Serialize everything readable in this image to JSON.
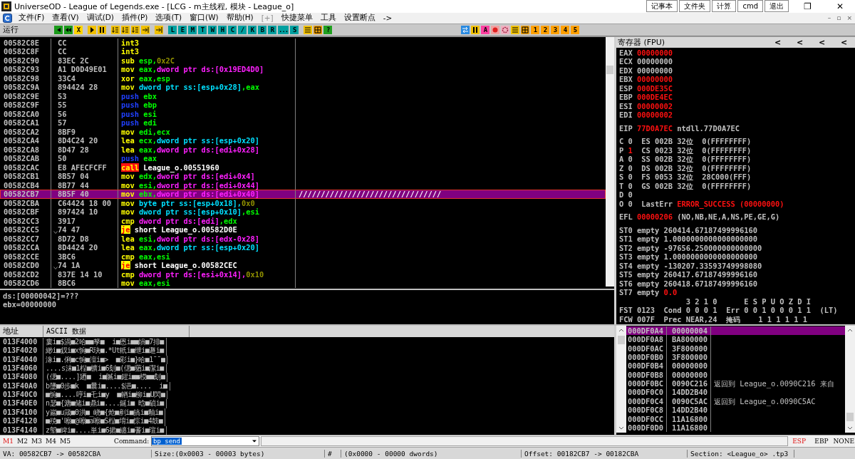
{
  "window": {
    "title": "UniverseOD - League of Legends.exe - [LCG - m主线程, 模块 - League_o]",
    "quick_buttons": [
      "记事本",
      "文件夹",
      "计算",
      "cmd",
      "退出"
    ],
    "controls": [
      "❐",
      "✕"
    ]
  },
  "menu": {
    "items": [
      {
        "label": "文件(F)",
        "dim": false
      },
      {
        "label": "查看(V)",
        "dim": false
      },
      {
        "label": "调试(D)",
        "dim": false
      },
      {
        "label": "插件(P)",
        "dim": false
      },
      {
        "label": "选项(T)",
        "dim": false
      },
      {
        "label": "窗口(W)",
        "dim": false
      },
      {
        "label": "帮助(H)",
        "dim": false
      },
      {
        "label": "[+]",
        "dim": true
      },
      {
        "label": "快捷菜单",
        "dim": false
      },
      {
        "label": "工具",
        "dim": false
      },
      {
        "label": "设置断点",
        "dim": false
      },
      {
        "label": "->",
        "dim": false
      }
    ],
    "mdi_controls": [
      "–",
      "▫",
      "×"
    ]
  },
  "toolbar": {
    "status": "运行",
    "groups": [
      [
        {
          "kind": "back"
        },
        {
          "kind": "fastback"
        },
        {
          "kind": "text",
          "label": "X",
          "color": "#ffd400"
        }
      ],
      [
        {
          "kind": "play"
        },
        {
          "kind": "pause"
        }
      ],
      [
        {
          "kind": "step"
        },
        {
          "kind": "step"
        },
        {
          "kind": "step"
        },
        {
          "kind": "stepout"
        }
      ],
      [
        {
          "kind": "stepout"
        }
      ],
      [
        {
          "kind": "text",
          "label": "L",
          "color": "#00a0a0"
        },
        {
          "kind": "text",
          "label": "E",
          "color": "#00a0a0"
        },
        {
          "kind": "text",
          "label": "M",
          "color": "#00a0a0"
        },
        {
          "kind": "text",
          "label": "T",
          "color": "#00a0a0"
        },
        {
          "kind": "text",
          "label": "W",
          "color": "#00a0a0"
        },
        {
          "kind": "text",
          "label": "H",
          "color": "#00a0a0"
        },
        {
          "kind": "text",
          "label": "C",
          "color": "#00a0a0"
        },
        {
          "kind": "text",
          "label": "/",
          "color": "#00a0a0"
        },
        {
          "kind": "text",
          "label": "K",
          "color": "#00a0a0"
        },
        {
          "kind": "text",
          "label": "B",
          "color": "#00a0a0"
        },
        {
          "kind": "text",
          "label": "R",
          "color": "#00a0a0"
        },
        {
          "kind": "text",
          "label": "...",
          "color": "#00a0a0"
        },
        {
          "kind": "text",
          "label": "S",
          "color": "#00a0a0"
        }
      ],
      [
        {
          "kind": "list"
        },
        {
          "kind": "grid"
        },
        {
          "kind": "text",
          "label": "?",
          "color": "#20a020"
        }
      ]
    ],
    "right_group": [
      {
        "kind": "swap"
      },
      {
        "kind": "pause"
      },
      {
        "kind": "text",
        "label": "A",
        "color": "#ff40a0"
      },
      {
        "kind": "circle"
      },
      {
        "kind": "gear"
      },
      {
        "kind": "list"
      },
      {
        "kind": "grid"
      },
      {
        "kind": "text",
        "label": "1",
        "color": "#ffa000"
      },
      {
        "kind": "text",
        "label": "2",
        "color": "#ffa000"
      },
      {
        "kind": "text",
        "label": "3",
        "color": "#ffa000"
      },
      {
        "kind": "text",
        "label": "4",
        "color": "#ffa000"
      },
      {
        "kind": "text",
        "label": "5",
        "color": "#ffa000"
      }
    ]
  },
  "disassembly": {
    "rows": [
      {
        "address": "00582C8E",
        "hex": "CC",
        "jump": false,
        "selected": false,
        "parts": [
          {
            "kind": "m",
            "text": "int3"
          }
        ]
      },
      {
        "address": "00582C8F",
        "hex": "CC",
        "jump": false,
        "selected": false,
        "parts": [
          {
            "kind": "m",
            "text": "int3"
          }
        ]
      },
      {
        "address": "00582C90",
        "hex": "83EC 2C",
        "jump": false,
        "selected": false,
        "parts": [
          {
            "kind": "m",
            "text": "sub"
          },
          {
            "kind": "r",
            "text": " esp,"
          },
          {
            "kind": "i",
            "text": "0x2C"
          }
        ]
      },
      {
        "address": "00582C93",
        "hex": "A1 D0D49E01",
        "jump": false,
        "selected": false,
        "parts": [
          {
            "kind": "m",
            "text": "mov"
          },
          {
            "kind": "r",
            "text": " eax,"
          },
          {
            "kind": "d",
            "text": "dword ptr ds:[0x19ED4D0]"
          }
        ]
      },
      {
        "address": "00582C98",
        "hex": "33C4",
        "jump": false,
        "selected": false,
        "parts": [
          {
            "kind": "m",
            "text": "xor"
          },
          {
            "kind": "r",
            "text": " eax,esp"
          }
        ]
      },
      {
        "address": "00582C9A",
        "hex": "894424 28",
        "jump": false,
        "selected": false,
        "parts": [
          {
            "kind": "m",
            "text": "mov"
          },
          {
            "kind": "s",
            "text": " dword ptr ss:[esp+0x28]"
          },
          {
            "kind": "r",
            "text": ",eax"
          }
        ]
      },
      {
        "address": "00582C9E",
        "hex": "53",
        "jump": false,
        "selected": false,
        "parts": [
          {
            "kind": "p",
            "text": "push"
          },
          {
            "kind": "r",
            "text": " ebx"
          }
        ]
      },
      {
        "address": "00582C9F",
        "hex": "55",
        "jump": false,
        "selected": false,
        "parts": [
          {
            "kind": "p",
            "text": "push"
          },
          {
            "kind": "r",
            "text": " ebp"
          }
        ]
      },
      {
        "address": "00582CA0",
        "hex": "56",
        "jump": false,
        "selected": false,
        "parts": [
          {
            "kind": "p",
            "text": "push"
          },
          {
            "kind": "r",
            "text": " esi"
          }
        ]
      },
      {
        "address": "00582CA1",
        "hex": "57",
        "jump": false,
        "selected": false,
        "parts": [
          {
            "kind": "p",
            "text": "push"
          },
          {
            "kind": "r",
            "text": " edi"
          }
        ]
      },
      {
        "address": "00582CA2",
        "hex": "8BF9",
        "jump": false,
        "selected": false,
        "parts": [
          {
            "kind": "m",
            "text": "mov"
          },
          {
            "kind": "r",
            "text": " edi,ecx"
          }
        ]
      },
      {
        "address": "00582CA4",
        "hex": "8D4C24 20",
        "jump": false,
        "selected": false,
        "parts": [
          {
            "kind": "m",
            "text": "lea"
          },
          {
            "kind": "r",
            "text": " ecx,"
          },
          {
            "kind": "s",
            "text": "dword ptr ss:[esp+0x20]"
          }
        ]
      },
      {
        "address": "00582CA8",
        "hex": "8D47 28",
        "jump": false,
        "selected": false,
        "parts": [
          {
            "kind": "m",
            "text": "lea"
          },
          {
            "kind": "r",
            "text": " eax,"
          },
          {
            "kind": "d",
            "text": "dword ptr ds:[edi+0x28]"
          }
        ]
      },
      {
        "address": "00582CAB",
        "hex": "50",
        "jump": false,
        "selected": false,
        "parts": [
          {
            "kind": "p",
            "text": "push"
          },
          {
            "kind": "r",
            "text": " eax"
          }
        ]
      },
      {
        "address": "00582CAC",
        "hex": "E8 AFECFCFF",
        "jump": false,
        "selected": false,
        "parts": [
          {
            "kind": "c",
            "text": "call"
          },
          {
            "kind": "t",
            "text": " League_o.00551960"
          }
        ]
      },
      {
        "address": "00582CB1",
        "hex": "8B57 04",
        "jump": false,
        "selected": false,
        "parts": [
          {
            "kind": "m",
            "text": "mov"
          },
          {
            "kind": "r",
            "text": " edx,"
          },
          {
            "kind": "d",
            "text": "dword ptr ds:[edi+0x4]"
          }
        ]
      },
      {
        "address": "00582CB4",
        "hex": "8B77 44",
        "jump": false,
        "selected": false,
        "parts": [
          {
            "kind": "m",
            "text": "mov"
          },
          {
            "kind": "r",
            "text": " esi,"
          },
          {
            "kind": "d",
            "text": "dword ptr ds:[edi+0x44]"
          }
        ]
      },
      {
        "address": "00582CB7",
        "hex": "8B5F 40",
        "jump": false,
        "selected": true,
        "comment": "////////////////////////////////",
        "parts": [
          {
            "kind": "m",
            "text": "mov"
          },
          {
            "kind": "r",
            "text": " ebx,"
          },
          {
            "kind": "d",
            "text": "dword ptr ds:[edi+0x40]"
          }
        ]
      },
      {
        "address": "00582CBA",
        "hex": "C64424 18 00",
        "jump": false,
        "selected": false,
        "parts": [
          {
            "kind": "m",
            "text": "mov"
          },
          {
            "kind": "s",
            "text": " byte ptr ss:[esp+0x18],"
          },
          {
            "kind": "i",
            "text": "0x0"
          }
        ]
      },
      {
        "address": "00582CBF",
        "hex": "897424 10",
        "jump": false,
        "selected": false,
        "parts": [
          {
            "kind": "m",
            "text": "mov"
          },
          {
            "kind": "s",
            "text": " dword ptr ss:[esp+0x10]"
          },
          {
            "kind": "r",
            "text": ",esi"
          }
        ]
      },
      {
        "address": "00582CC3",
        "hex": "3917",
        "jump": false,
        "selected": false,
        "parts": [
          {
            "kind": "m",
            "text": "cmp"
          },
          {
            "kind": "d",
            "text": " dword ptr ds:[edi]"
          },
          {
            "kind": "r",
            "text": ",edx"
          }
        ]
      },
      {
        "address": "00582CC5",
        "hex": "74 47",
        "jump": true,
        "selected": false,
        "parts": [
          {
            "kind": "j",
            "text": "je"
          },
          {
            "kind": "t",
            "text": " short League_o.00582D0E"
          }
        ]
      },
      {
        "address": "00582CC7",
        "hex": "8D72 D8",
        "jump": false,
        "selected": false,
        "parts": [
          {
            "kind": "m",
            "text": "lea"
          },
          {
            "kind": "r",
            "text": " esi,"
          },
          {
            "kind": "d",
            "text": "dword ptr ds:[edx-0x28]"
          }
        ]
      },
      {
        "address": "00582CCA",
        "hex": "8D4424 20",
        "jump": false,
        "selected": false,
        "parts": [
          {
            "kind": "m",
            "text": "lea"
          },
          {
            "kind": "r",
            "text": " eax,"
          },
          {
            "kind": "s",
            "text": "dword ptr ss:[esp+0x20]"
          }
        ]
      },
      {
        "address": "00582CCE",
        "hex": "3BC6",
        "jump": false,
        "selected": false,
        "parts": [
          {
            "kind": "m",
            "text": "cmp"
          },
          {
            "kind": "r",
            "text": " eax,esi"
          }
        ]
      },
      {
        "address": "00582CD0",
        "hex": "74 1A",
        "jump": true,
        "selected": false,
        "parts": [
          {
            "kind": "j",
            "text": "je"
          },
          {
            "kind": "t",
            "text": " short League_o.00582CEC"
          }
        ]
      },
      {
        "address": "00582CD2",
        "hex": "837E 14 10",
        "jump": false,
        "selected": false,
        "parts": [
          {
            "kind": "m",
            "text": "cmp"
          },
          {
            "kind": "d",
            "text": " dword ptr ds:[esi+0x14],"
          },
          {
            "kind": "i",
            "text": "0x10"
          }
        ]
      },
      {
        "address": "00582CD6",
        "hex": "8BC6",
        "jump": false,
        "selected": false,
        "parts": [
          {
            "kind": "m",
            "text": "mov"
          },
          {
            "kind": "r",
            "text": " eax,esi"
          }
        ]
      }
    ]
  },
  "info": [
    "ds:[00000042]=???",
    "ebx=00000000"
  ],
  "registers": {
    "title": "寄存器 (FPU)",
    "nav": [
      "<",
      "<",
      "<",
      "<"
    ],
    "groups": [
      [
        [
          {
            "text": "EAX ",
            "changed": false
          },
          {
            "text": "00000000",
            "changed": true
          }
        ],
        [
          {
            "text": "ECX 00000000",
            "changed": false
          }
        ],
        [
          {
            "text": "EDX 00000000",
            "changed": false
          }
        ],
        [
          {
            "text": "EBX ",
            "changed": false
          },
          {
            "text": "00000000",
            "changed": true
          }
        ],
        [
          {
            "text": "ESP ",
            "changed": false
          },
          {
            "text": "000DE35C",
            "changed": true
          }
        ],
        [
          {
            "text": "EBP ",
            "changed": false
          },
          {
            "text": "000DE4EC",
            "changed": true
          }
        ],
        [
          {
            "text": "ESI ",
            "changed": false
          },
          {
            "text": "00000002",
            "changed": true
          }
        ],
        [
          {
            "text": "EDI ",
            "changed": false
          },
          {
            "text": "00000002",
            "changed": true
          }
        ]
      ],
      [
        [
          {
            "text": "EIP ",
            "changed": false
          },
          {
            "text": "77D0A7EC",
            "changed": true
          },
          {
            "text": " ntdll.77D0A7EC",
            "changed": false
          }
        ]
      ],
      [
        [
          {
            "text": "C 0  ES 002B 32位  0(FFFFFFFF)",
            "changed": false
          }
        ],
        [
          {
            "text": "P ",
            "changed": false
          },
          {
            "text": "1",
            "changed": true
          },
          {
            "text": "  CS 0023 32位  0(FFFFFFFF)",
            "changed": false
          }
        ],
        [
          {
            "text": "A 0  SS 002B 32位  0(FFFFFFFF)",
            "changed": false
          }
        ],
        [
          {
            "text": "Z 0  DS 002B 32位  0(FFFFFFFF)",
            "changed": false
          }
        ],
        [
          {
            "text": "S 0  FS 0053 32位  28C000(FFF)",
            "changed": false
          }
        ],
        [
          {
            "text": "T 0  GS 002B 32位  0(FFFFFFFF)",
            "changed": false
          }
        ],
        [
          {
            "text": "D 0",
            "changed": false
          }
        ],
        [
          {
            "text": "O 0  LastErr ",
            "changed": false
          },
          {
            "text": "ERROR_SUCCESS (00000000)",
            "changed": true
          }
        ]
      ],
      [
        [
          {
            "text": "EFL ",
            "changed": false
          },
          {
            "text": "00000206",
            "changed": true
          },
          {
            "text": " (NO,NB,NE,A,NS,PE,GE,G)",
            "changed": false
          }
        ]
      ],
      [
        [
          {
            "text": "ST0 empty 260414.67187499996160",
            "changed": false
          }
        ],
        [
          {
            "text": "ST1 empty 1.0000000000000000000",
            "changed": false
          }
        ],
        [
          {
            "text": "ST2 empty -97656.250000000000000",
            "changed": false
          }
        ],
        [
          {
            "text": "ST3 empty 1.0000000000000000000",
            "changed": false
          }
        ],
        [
          {
            "text": "ST4 empty -130207.33593749998080",
            "changed": false
          }
        ],
        [
          {
            "text": "ST5 empty 260417.67187499996160",
            "changed": false
          }
        ],
        [
          {
            "text": "ST6 empty 260418.67187499996160",
            "changed": false
          }
        ],
        [
          {
            "text": "ST7 empty ",
            "changed": false
          },
          {
            "text": "0.0",
            "changed": true
          }
        ],
        [
          {
            "text": "               3 2 1 0      E S P U O Z D I",
            "changed": false
          }
        ],
        [
          {
            "text": "FST 0123  Cond 0 0 0 1  Err 0 0 1 0 0 0 1 1  (LT)",
            "changed": false
          }
        ],
        [
          {
            "text": "FCW 007F  Prec NEAR,24  掩码    1 1 1 1 1 1",
            "changed": false
          }
        ]
      ]
    ]
  },
  "dump": {
    "columns": [
      "地址",
      "ASCII 数据"
    ],
    "rows": [
      {
        "address": "013F4000",
        "ascii": "婁i■$渦■2哈■■孥■  i■恩i■■熉■7排■"
      },
      {
        "address": "013F4020",
        "ascii": "緲i■釵i■x惋■R玦■.*Ut軝i■绁i■遯i■"
      },
      {
        "address": "013F4040",
        "ascii": "潒i■.俐■c惋■澶i■>  ■彩i■}哈■1¯¯■"
      },
      {
        "address": "013F4060",
        "ascii": "....s沫■1桯■櫎i■6刬■(偲■蕕i■潔i■"
      },
      {
        "address": "013F4080",
        "ascii": "(偲■....]廼■  i■贓i■鍟i■■模■■刬■"
      },
      {
        "address": "013F40A0",
        "ascii": "b墬■0歩■k  ■曩i■....$浥■....  i■"
      },
      {
        "address": "013F40C0",
        "ascii": "■惋■....哼i■乇i■y  ■輶i■柳i■U閃■"
      },
      {
        "address": "013F40E0",
        "ascii": "n瑟■{溏■储i■鼎i■....鋋i■ 晗■碵i■"
      },
      {
        "address": "013F4100",
        "ascii": "y巖■u箴■0洪■_峣■{炝■剷i■搞i■釉i■"
      },
      {
        "address": "013F4120",
        "ascii": "■殑■'嚓■@嚓■a嚓■S桯■堉i■悰i■4鼓■"
      },
      {
        "address": "013F4140",
        "ascii": "z塱■睥i■....単i■6捃■纏i■蓍i■瑄i■"
      }
    ]
  },
  "stack": {
    "rows": [
      {
        "address": "000DF0A4",
        "value": "00000004",
        "selected": true
      },
      {
        "address": "000DF0A8",
        "value": "BA800000",
        "selected": false
      },
      {
        "address": "000DF0AC",
        "value": "3F800000",
        "selected": false
      },
      {
        "address": "000DF0B0",
        "value": "3F800000",
        "selected": false
      },
      {
        "address": "000DF0B4",
        "value": "00000000",
        "selected": false
      },
      {
        "address": "000DF0B8",
        "value": "00000000",
        "selected": false
      },
      {
        "address": "000DF0BC",
        "value": "0090C216",
        "selected": false,
        "comment": "返回到 League_o.0090C216 来自"
      },
      {
        "address": "000DF0C0",
        "value": "14DD2B40",
        "selected": false
      },
      {
        "address": "000DF0C4",
        "value": "0090C5AC",
        "selected": false,
        "comment": "返回到 League_o.0090C5AC"
      },
      {
        "address": "000DF0C8",
        "value": "14DD2B40",
        "selected": false
      },
      {
        "address": "000DF0CC",
        "value": "11A16800",
        "selected": false
      },
      {
        "address": "000DF0D0",
        "value": "11A16800",
        "selected": false
      }
    ]
  },
  "command_bar": {
    "tabs": [
      {
        "label": "M1",
        "selected": true
      },
      {
        "label": "M2",
        "selected": false
      },
      {
        "label": "M3",
        "selected": false
      },
      {
        "label": "M4",
        "selected": false
      },
      {
        "label": "M5",
        "selected": false
      }
    ],
    "label": "Command:",
    "value": "bp send",
    "modes": [
      {
        "label": "ESP",
        "selected": true
      },
      {
        "label": "EBP",
        "selected": false
      },
      {
        "label": "NONE",
        "selected": false
      }
    ]
  },
  "status_bar": [
    "VA: 00582CB7 -> 00582CBA",
    "Size:(0x0003 - 00003 bytes)",
    "#",
    "(0x0000 - 00000 dwords)",
    "Offset: 00182CB7 -> 00182CBA",
    "Section: <League_o> .tp3"
  ]
}
